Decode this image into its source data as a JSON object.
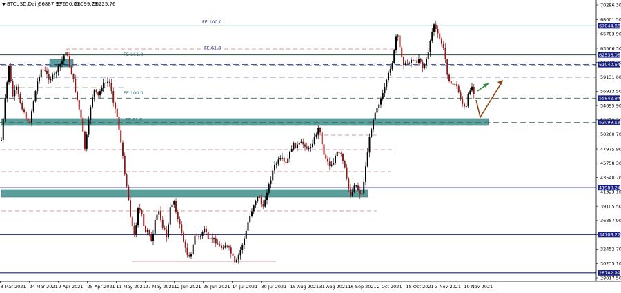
{
  "chart_data": {
    "type": "candlestick",
    "header": {
      "symbol": "BTCUSD,Daily",
      "open": "56887.93",
      "high": "57650.00",
      "low": "56099.26",
      "close": "56225.76"
    },
    "x_tick_labels": [
      "8 Mar 2021",
      "24 Mar 2021",
      "9 Apr 2021",
      "25 Apr 2021",
      "11 May 2021",
      "27 May 2021",
      "12 Jun 2021",
      "28 Jun 2021",
      "14 Jul 2021",
      "30 Jul 2021",
      "15 Aug 2021",
      "31 Aug 2021",
      "16 Sep 2021",
      "2 Oct 2021",
      "18 Oct 2021",
      "3 Nov 2021",
      "19 Nov 2021"
    ],
    "y_tick_labels": [
      "70286.30",
      "68001.50",
      "65783.90",
      "63566.30",
      "61348.70",
      "59131.00",
      "56913.50",
      "54695.90",
      "52478.20",
      "50260.70",
      "47975.90",
      "45758.30",
      "43540.70",
      "41323.10",
      "39105.50",
      "36887.90",
      "34670.30",
      "32452.70",
      "30235.10",
      "28017.50"
    ],
    "ylim": [
      27500,
      71300
    ],
    "levels": [
      {
        "label": "67044.68",
        "price": 67044.68,
        "style": "solid",
        "color": "#3d6650"
      },
      {
        "label": "62536.08",
        "price": 62536.08,
        "style": "solid",
        "color": "#3d6650"
      },
      {
        "label": "61040.64",
        "price": 61040.64,
        "style": "dashed",
        "color": "#1a237e"
      },
      {
        "label": "55842.84",
        "price": 55842.84,
        "style": "dashed",
        "color": "#3d6650"
      },
      {
        "label": "52099.18",
        "price": 52099.18,
        "style": "dashed",
        "color": "#3d6650"
      },
      {
        "label": "41980.24",
        "price": 41980.24,
        "style": "solid",
        "color": "#1a237e"
      },
      {
        "label": "34708.27",
        "price": 34708.27,
        "style": "solid",
        "color": "#1a237e"
      },
      {
        "label": "28782.99",
        "price": 28782.99,
        "style": "solid",
        "color": "#1a237e"
      }
    ],
    "fe_labels": [
      {
        "text": "FE 100.0",
        "price": 67300
      },
      {
        "text": "FE 61.8",
        "price": 63300
      },
      {
        "text": "FE 161.8",
        "price": 62300
      },
      {
        "text": "FE 100.0",
        "price": 56300
      },
      {
        "text": "FE 61.8",
        "price": 52200
      }
    ],
    "colors": {
      "bull": "#000000",
      "bear": "#8b1a1a",
      "zone": "#5b9e9b",
      "arrow_up": "#2e8b3c",
      "arrow_brown": "#8b4513",
      "price_box": "#1a237e"
    }
  }
}
